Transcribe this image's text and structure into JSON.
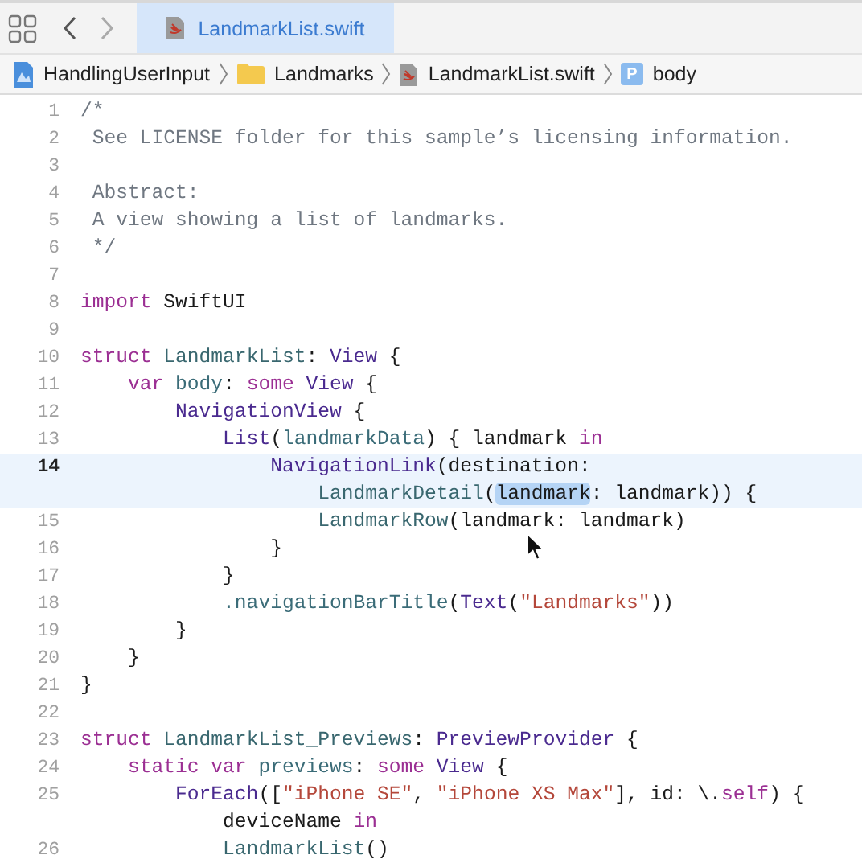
{
  "tab_bar": {
    "tabs": [
      {
        "label": "LandmarkList.swift",
        "selected": true
      }
    ]
  },
  "breadcrumbs": [
    {
      "kind": "project",
      "label": "HandlingUserInput"
    },
    {
      "kind": "folder",
      "label": "Landmarks"
    },
    {
      "kind": "swift-file",
      "label": "LandmarkList.swift"
    },
    {
      "kind": "property",
      "label": "body",
      "badge": "P"
    }
  ],
  "editor": {
    "lines": [
      {
        "number": "1",
        "current": false,
        "rows": [
          {
            "tokens": [
              {
                "kind": "comment",
                "text": "/*"
              }
            ]
          }
        ]
      },
      {
        "number": "2",
        "current": false,
        "rows": [
          {
            "tokens": [
              {
                "kind": "comment",
                "text": " See LICENSE folder for this sample’s licensing information."
              }
            ]
          }
        ]
      },
      {
        "number": "3",
        "current": false
      },
      {
        "number": "4",
        "current": false,
        "rows": [
          {
            "tokens": [
              {
                "kind": "comment",
                "text": " Abstract:"
              }
            ]
          }
        ]
      },
      {
        "number": "5",
        "current": false,
        "rows": [
          {
            "tokens": [
              {
                "kind": "comment",
                "text": " A view showing a list of landmarks."
              }
            ]
          }
        ]
      },
      {
        "number": "6",
        "current": false,
        "rows": [
          {
            "tokens": [
              {
                "kind": "comment",
                "text": " */"
              }
            ]
          }
        ]
      },
      {
        "number": "7",
        "current": false
      },
      {
        "number": "8",
        "current": false,
        "rows": [
          {
            "tokens": [
              {
                "kind": "keyword",
                "text": "import"
              },
              {
                "kind": "plain",
                "text": " SwiftUI"
              }
            ]
          }
        ]
      },
      {
        "number": "9",
        "current": false
      },
      {
        "number": "10",
        "current": false,
        "rows": [
          {
            "tokens": [
              {
                "kind": "keyword",
                "text": "struct"
              },
              {
                "kind": "project-type",
                "text": " LandmarkList"
              },
              {
                "kind": "plain",
                "text": ": "
              },
              {
                "kind": "type",
                "text": "View"
              },
              {
                "kind": "plain",
                "text": " {"
              }
            ]
          }
        ]
      },
      {
        "number": "11",
        "current": false,
        "rows": [
          {
            "tokens": [
              {
                "kind": "keyword",
                "text": "    var"
              },
              {
                "kind": "member",
                "text": " body"
              },
              {
                "kind": "plain",
                "text": ": "
              },
              {
                "kind": "keyword",
                "text": "some"
              },
              {
                "kind": "type",
                "text": " View"
              },
              {
                "kind": "plain",
                "text": " {"
              }
            ]
          }
        ]
      },
      {
        "number": "12",
        "current": false,
        "rows": [
          {
            "tokens": [
              {
                "kind": "type",
                "text": "        NavigationView"
              },
              {
                "kind": "plain",
                "text": " {"
              }
            ]
          }
        ]
      },
      {
        "number": "13",
        "current": false,
        "rows": [
          {
            "tokens": [
              {
                "kind": "type",
                "text": "            List"
              },
              {
                "kind": "plain",
                "text": "("
              },
              {
                "kind": "member",
                "text": "landmarkData"
              },
              {
                "kind": "plain",
                "text": ") { landmark "
              },
              {
                "kind": "keyword",
                "text": "in"
              }
            ]
          }
        ]
      },
      {
        "number": "14",
        "current": true,
        "rows": [
          {
            "tokens": [
              {
                "kind": "type",
                "text": "                NavigationLink"
              },
              {
                "kind": "plain",
                "text": "(destination:"
              }
            ]
          },
          {
            "tokens": [
              {
                "kind": "project-type",
                "text": "                    LandmarkDetail"
              },
              {
                "kind": "plain",
                "text": "("
              },
              {
                "kind": "selection",
                "text": "landmark"
              },
              {
                "kind": "plain",
                "text": ": landmark)) {"
              }
            ]
          }
        ]
      },
      {
        "number": "15",
        "current": false,
        "rows": [
          {
            "tokens": [
              {
                "kind": "project-type",
                "text": "                    LandmarkRow"
              },
              {
                "kind": "plain",
                "text": "(landmark: landmark)"
              }
            ]
          }
        ]
      },
      {
        "number": "16",
        "current": false,
        "rows": [
          {
            "tokens": [
              {
                "kind": "plain",
                "text": "                }"
              }
            ]
          }
        ]
      },
      {
        "number": "17",
        "current": false,
        "rows": [
          {
            "tokens": [
              {
                "kind": "plain",
                "text": "            }"
              }
            ]
          }
        ]
      },
      {
        "number": "18",
        "current": false,
        "rows": [
          {
            "tokens": [
              {
                "kind": "member",
                "text": "            .navigationBarTitle"
              },
              {
                "kind": "plain",
                "text": "("
              },
              {
                "kind": "type",
                "text": "Text"
              },
              {
                "kind": "plain",
                "text": "("
              },
              {
                "kind": "string",
                "text": "\"Landmarks\""
              },
              {
                "kind": "plain",
                "text": "))"
              }
            ]
          }
        ]
      },
      {
        "number": "19",
        "current": false,
        "rows": [
          {
            "tokens": [
              {
                "kind": "plain",
                "text": "        }"
              }
            ]
          }
        ]
      },
      {
        "number": "20",
        "current": false,
        "rows": [
          {
            "tokens": [
              {
                "kind": "plain",
                "text": "    }"
              }
            ]
          }
        ]
      },
      {
        "number": "21",
        "current": false,
        "rows": [
          {
            "tokens": [
              {
                "kind": "plain",
                "text": "}"
              }
            ]
          }
        ]
      },
      {
        "number": "22",
        "current": false
      },
      {
        "number": "23",
        "current": false,
        "rows": [
          {
            "tokens": [
              {
                "kind": "keyword",
                "text": "struct"
              },
              {
                "kind": "project-type",
                "text": " LandmarkList_Previews"
              },
              {
                "kind": "plain",
                "text": ": "
              },
              {
                "kind": "type",
                "text": "PreviewProvider"
              },
              {
                "kind": "plain",
                "text": " {"
              }
            ]
          }
        ]
      },
      {
        "number": "24",
        "current": false,
        "rows": [
          {
            "tokens": [
              {
                "kind": "keyword",
                "text": "    static var"
              },
              {
                "kind": "member",
                "text": " previews"
              },
              {
                "kind": "plain",
                "text": ": "
              },
              {
                "kind": "keyword",
                "text": "some"
              },
              {
                "kind": "type",
                "text": " View"
              },
              {
                "kind": "plain",
                "text": " {"
              }
            ]
          }
        ]
      },
      {
        "number": "25",
        "current": false,
        "rows": [
          {
            "tokens": [
              {
                "kind": "type",
                "text": "        ForEach"
              },
              {
                "kind": "plain",
                "text": "(["
              },
              {
                "kind": "string",
                "text": "\"iPhone SE\""
              },
              {
                "kind": "plain",
                "text": ", "
              },
              {
                "kind": "string",
                "text": "\"iPhone XS Max\""
              },
              {
                "kind": "plain",
                "text": "], id: \\."
              },
              {
                "kind": "keyword",
                "text": "self"
              },
              {
                "kind": "plain",
                "text": ") {"
              }
            ]
          },
          {
            "tokens": [
              {
                "kind": "plain",
                "text": "            deviceName "
              },
              {
                "kind": "keyword",
                "text": "in"
              }
            ]
          }
        ]
      },
      {
        "number": "26",
        "current": false,
        "rows": [
          {
            "tokens": [
              {
                "kind": "project-type",
                "text": "            LandmarkList"
              },
              {
                "kind": "plain",
                "text": "()"
              }
            ]
          }
        ]
      }
    ]
  }
}
